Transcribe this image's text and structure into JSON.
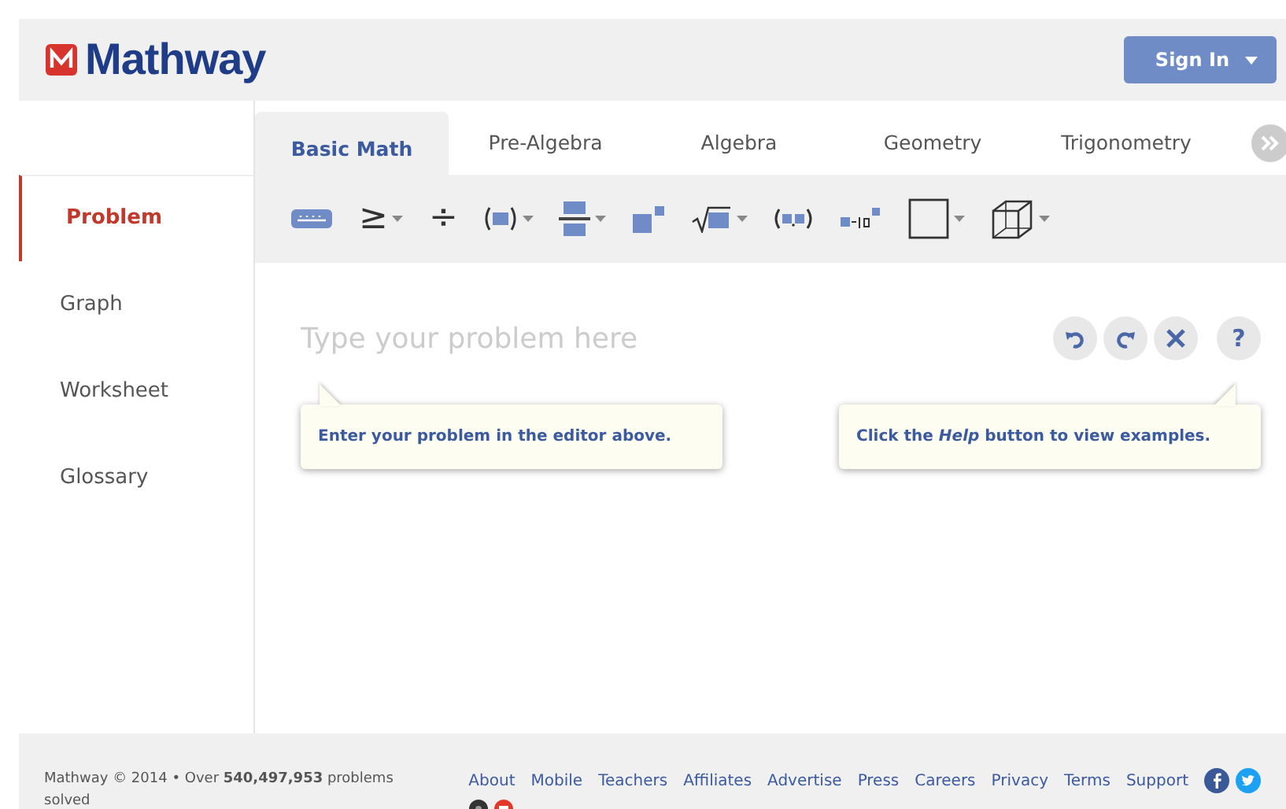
{
  "header": {
    "logo": "Mathway",
    "sign_in": "Sign In"
  },
  "tabs": [
    {
      "label": "Basic Math",
      "selected": true
    },
    {
      "label": "Pre-Algebra",
      "selected": false
    },
    {
      "label": "Algebra",
      "selected": false
    },
    {
      "label": "Geometry",
      "selected": false
    },
    {
      "label": "Trigonometry",
      "selected": false
    }
  ],
  "sidebar": {
    "items": [
      {
        "label": "Problem",
        "selected": true
      },
      {
        "label": "Graph",
        "selected": false
      },
      {
        "label": "Worksheet",
        "selected": false
      },
      {
        "label": "Glossary",
        "selected": false
      }
    ]
  },
  "toolbar": [
    {
      "kind": "keyboard",
      "dropdown": false
    },
    {
      "kind": "symbol",
      "symbol": "≥",
      "dropdown": true
    },
    {
      "kind": "symbol",
      "symbol": "÷",
      "dropdown": false
    },
    {
      "kind": "parens",
      "dropdown": true
    },
    {
      "kind": "fraction",
      "dropdown": true
    },
    {
      "kind": "power",
      "dropdown": false
    },
    {
      "kind": "root",
      "dropdown": true
    },
    {
      "kind": "pair",
      "dropdown": false
    },
    {
      "kind": "scientific",
      "dropdown": false
    },
    {
      "kind": "square",
      "dropdown": true
    },
    {
      "kind": "cube",
      "dropdown": true
    }
  ],
  "editor": {
    "placeholder": "Type your problem here",
    "help": "?"
  },
  "hints": [
    {
      "text": "Enter your problem in the editor above."
    },
    {
      "text": "Click the *Help* button to view examples."
    }
  ],
  "footer": {
    "copyright": "Mathway © 2014  •  Over **540,497,953** problems solved",
    "links": [
      "About",
      "Mobile",
      "Teachers",
      "Affiliates",
      "Advertise",
      "Press",
      "Careers",
      "Privacy",
      "Terms",
      "Support"
    ]
  }
}
